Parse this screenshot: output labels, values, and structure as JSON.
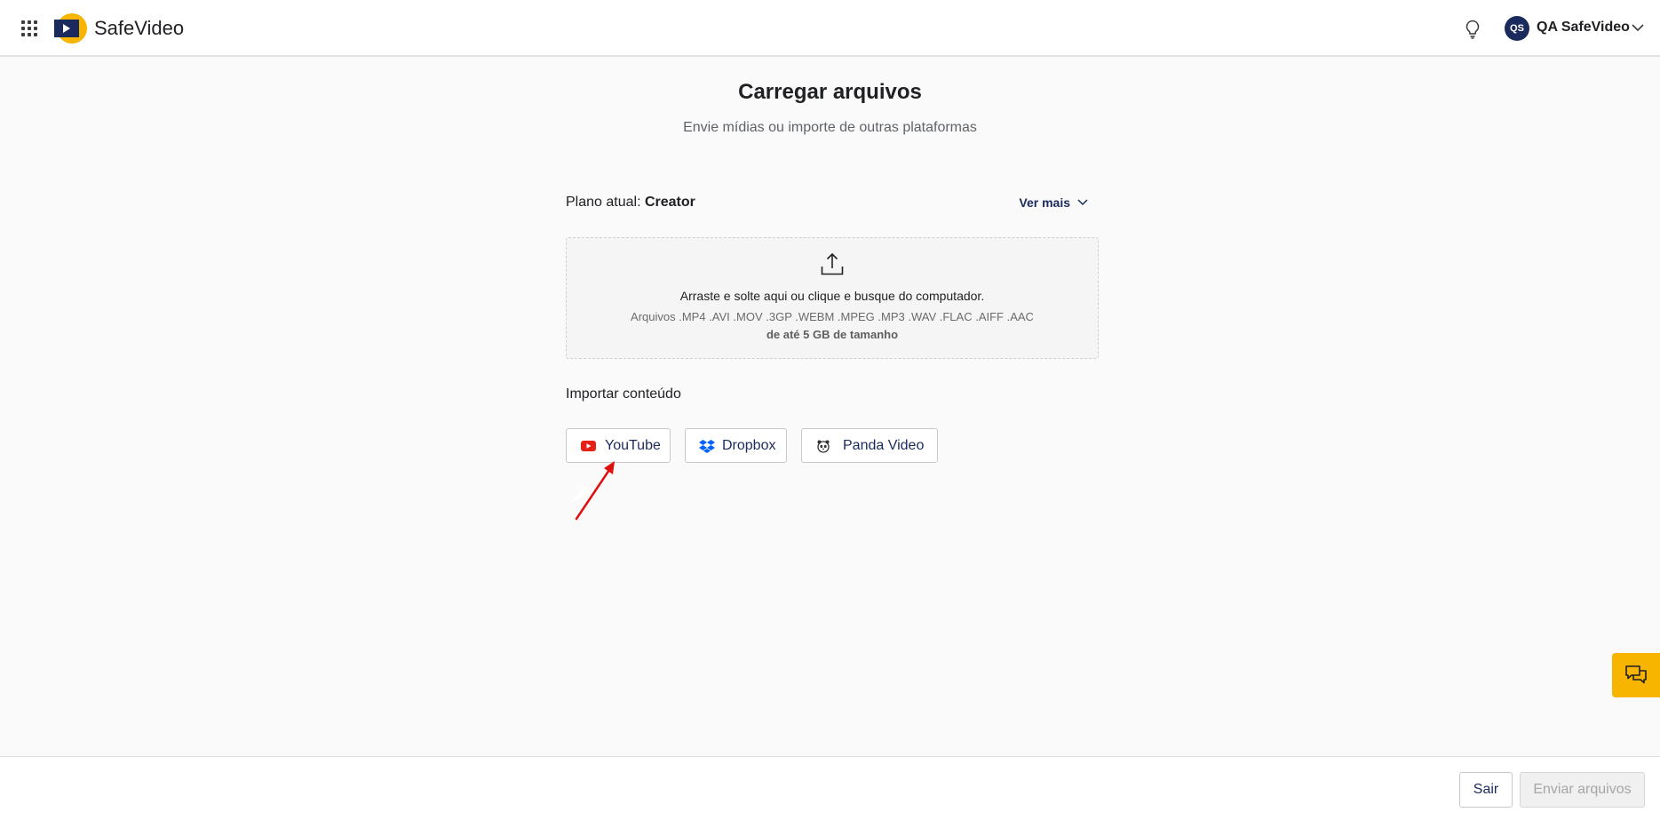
{
  "header": {
    "apps_icon": "grid-apps-icon",
    "brand": "SafeVideo",
    "logo_colors": {
      "circle": "#f7b500",
      "square": "#1b2a5c"
    },
    "bulb_icon": "lightbulb-icon",
    "user": {
      "initials": "QS",
      "name": "QA SafeVideo"
    }
  },
  "main": {
    "title": "Carregar arquivos",
    "subtitle": "Envie mídias ou importe de outras plataformas",
    "plan": {
      "label": "Plano atual: ",
      "value": "Creator",
      "more_label": "Ver mais"
    },
    "dropzone": {
      "icon": "upload-icon",
      "main_text": "Arraste e solte aqui ou clique e busque do computador.",
      "formats": "Arquivos .MP4 .AVI .MOV .3GP .WEBM .MPEG .MP3 .WAV .FLAC .AIFF .AAC",
      "size_limit": "de até 5 GB de tamanho"
    },
    "import": {
      "title": "Importar conteúdo",
      "buttons": [
        {
          "label": "YouTube",
          "icon": "youtube-icon"
        },
        {
          "label": "Dropbox",
          "icon": "dropbox-icon"
        },
        {
          "label": "Panda Video",
          "icon": "panda-icon"
        }
      ]
    }
  },
  "colors": {
    "accent": "#f7b500",
    "navy": "#1b2a5c",
    "annotation_arrow": "#e01010"
  },
  "footer": {
    "exit_label": "Sair",
    "submit_label": "Enviar arquivos"
  }
}
